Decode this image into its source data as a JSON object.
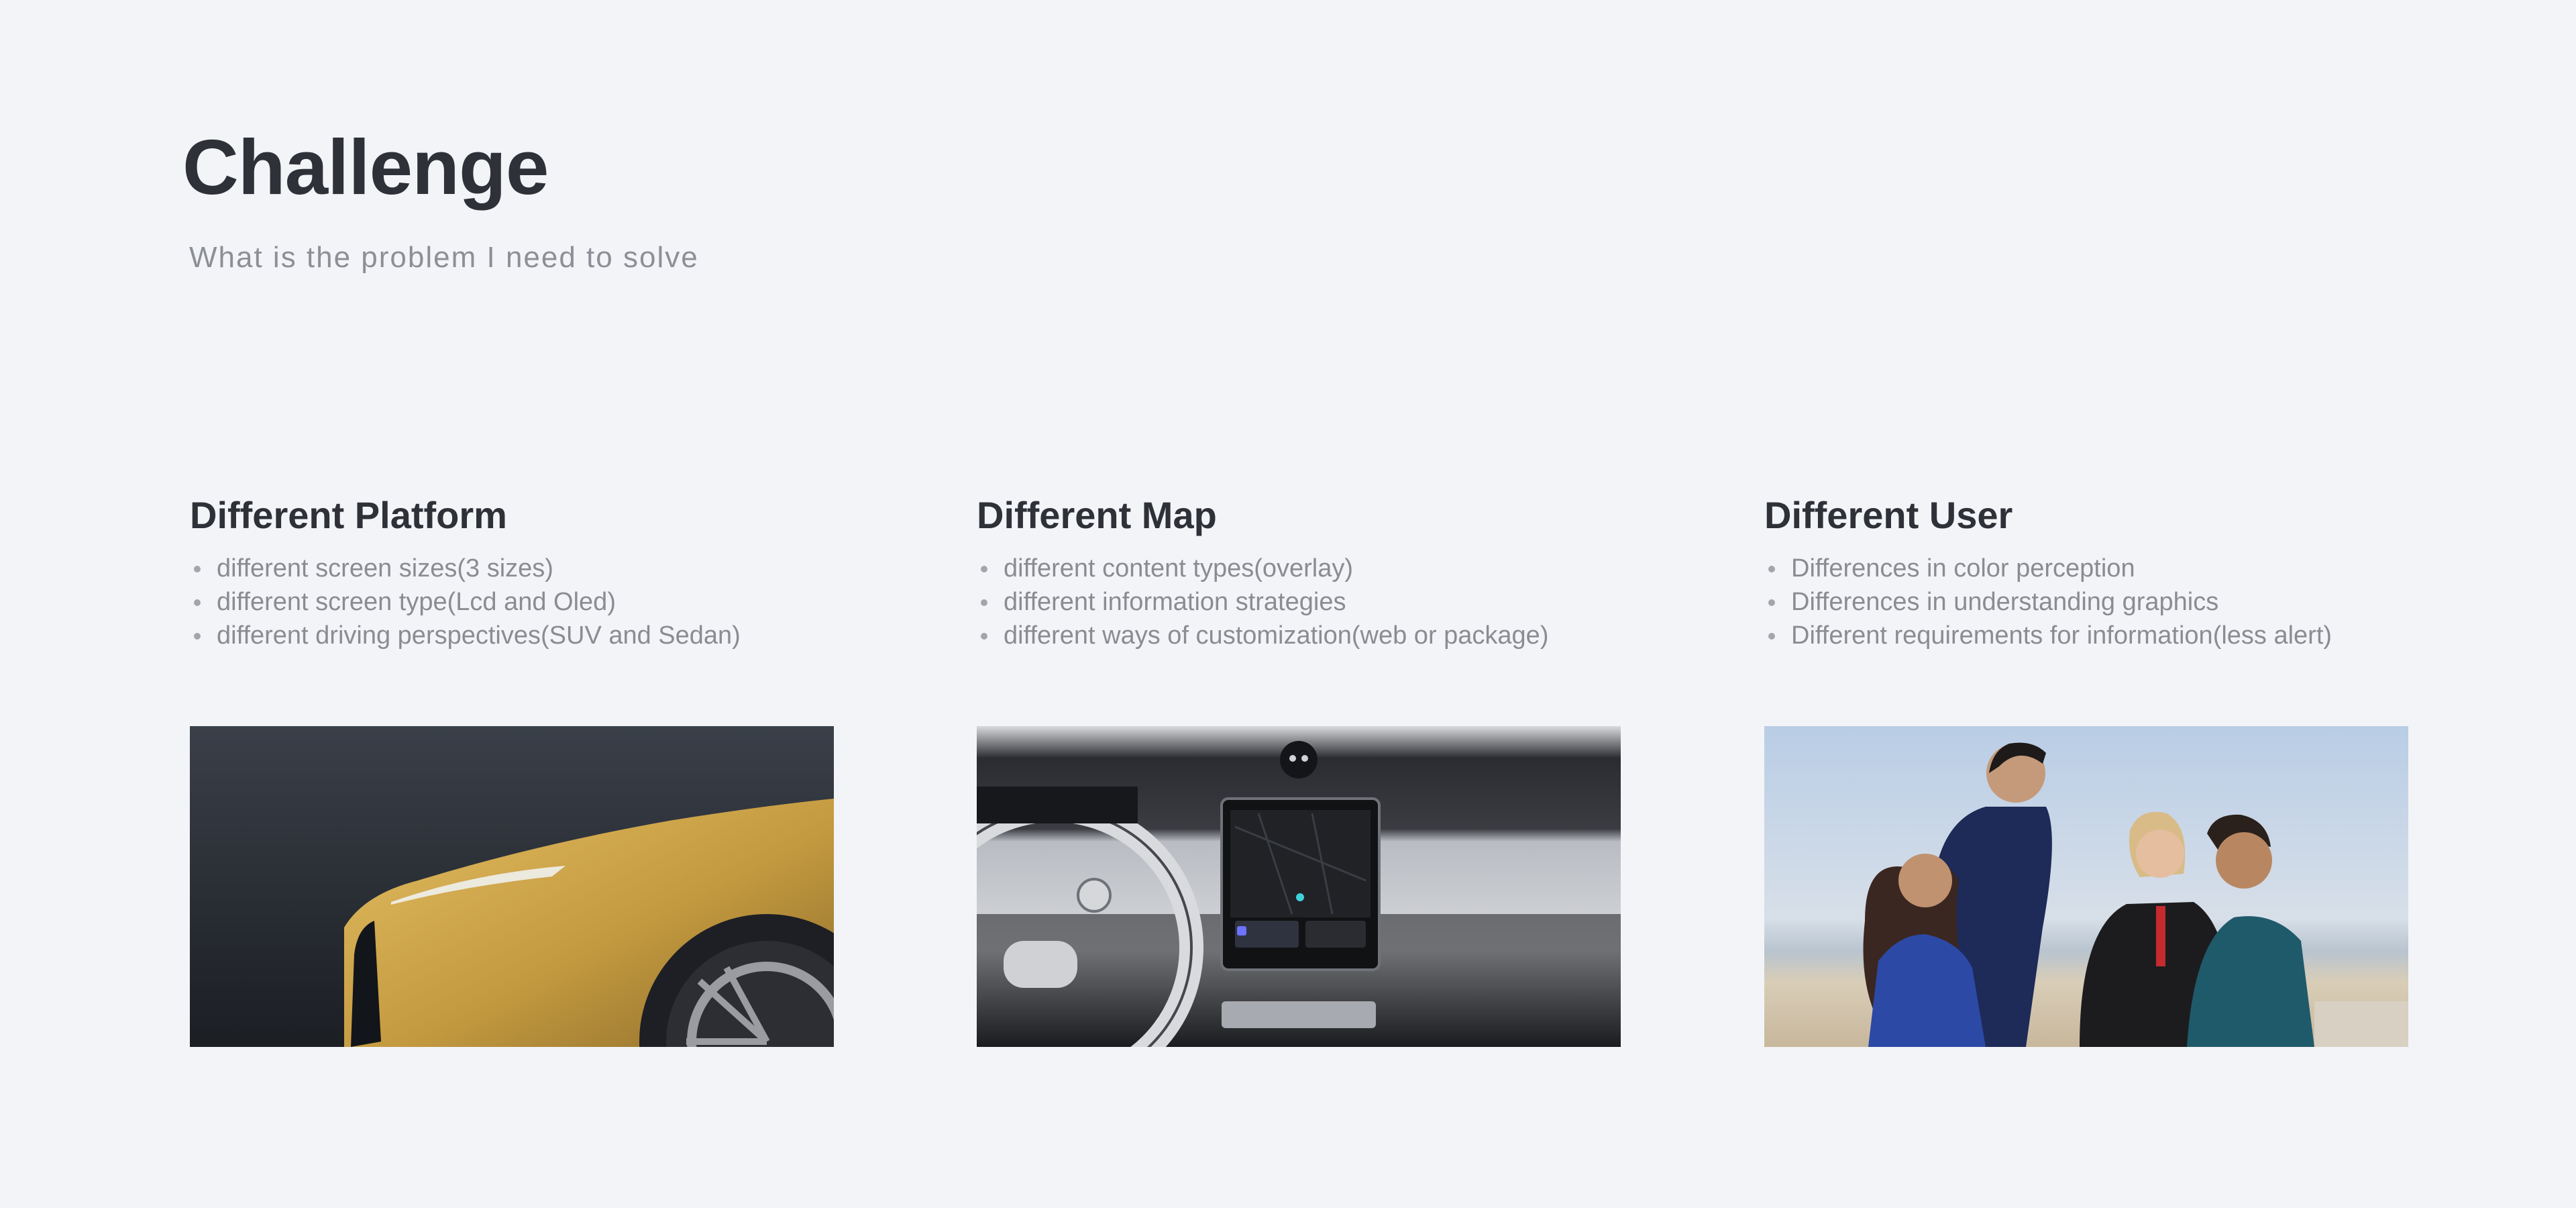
{
  "header": {
    "title": "Challenge",
    "subtitle": "What is the problem I need to solve"
  },
  "columns": [
    {
      "title": "Different Platform",
      "bullets": [
        "different screen sizes(3 sizes)",
        "different screen type(Lcd and Oled)",
        "different driving perspectives(SUV and Sedan)"
      ],
      "image": "car-exterior-photo"
    },
    {
      "title": "Different Map",
      "bullets": [
        "different content types(overlay)",
        "different information strategies",
        "different ways of customization(web or package)"
      ],
      "image": "car-interior-dashboard-photo"
    },
    {
      "title": "Different User",
      "bullets": [
        "Differences in color perception",
        "Differences in understanding graphics",
        "Different requirements for information(less alert)"
      ],
      "image": "group-of-people-photo"
    }
  ],
  "colors": {
    "background": "#f3f4f8",
    "heading": "#2f3138",
    "body_text": "#8a8c92",
    "car_paint": "#c9a24a"
  }
}
